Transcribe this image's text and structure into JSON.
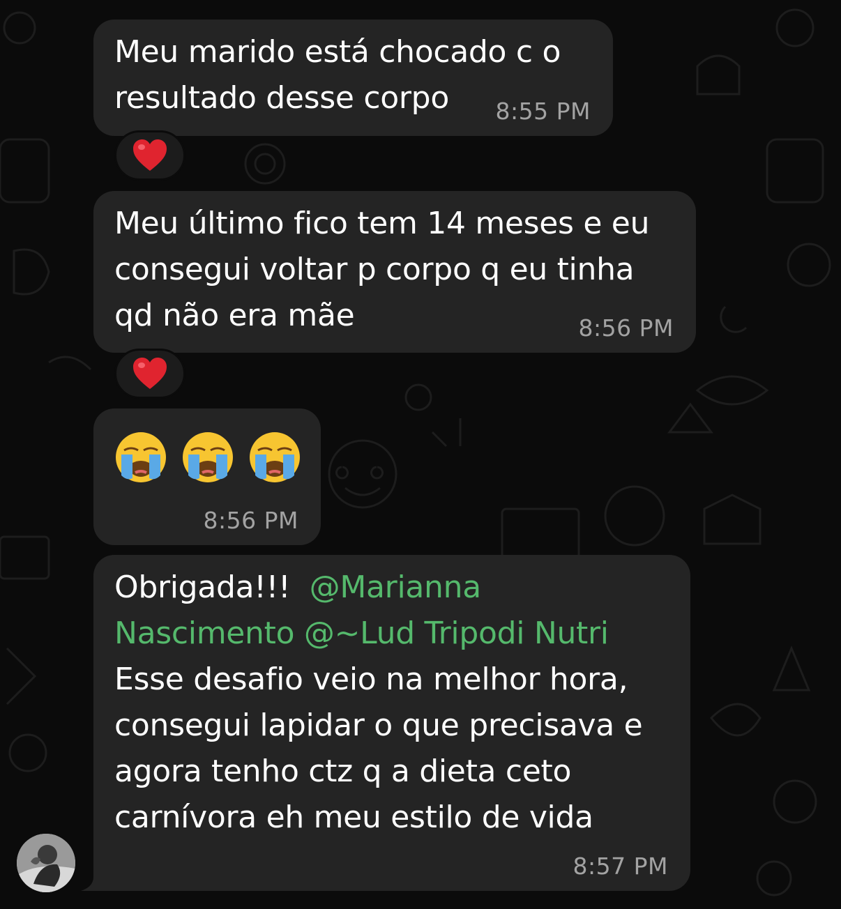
{
  "messages": [
    {
      "lines": [
        "Meu marido está chocado c o",
        "resultado desse corpo"
      ],
      "time": "8:55 PM",
      "reaction": "heart"
    },
    {
      "lines": [
        "Meu último fico tem 14 meses e eu",
        "consegui voltar p corpo q eu tinha",
        "qd não era mãe"
      ],
      "time": "8:56 PM",
      "reaction": "heart"
    },
    {
      "emojis": [
        "loudly-crying-face",
        "loudly-crying-face",
        "loudly-crying-face"
      ],
      "time": "8:56 PM"
    },
    {
      "line1_text": "Obrigada!!!  ",
      "mention1_part1": "@Marianna",
      "mention1_part2": "Nascimento",
      "mention2": "@~Lud Tripodi Nutri",
      "lines": [
        "Esse desafio veio na melhor hora,",
        "consegui lapidar o que precisava e",
        "agora tenho ctz q a dieta ceto",
        "carnívora eh meu estilo de vida"
      ],
      "time": "8:57 PM"
    }
  ],
  "colors": {
    "background": "#0b0b0b",
    "bubble": "#242424",
    "text": "#ffffff",
    "timestamp": "#a3a3a3",
    "mention": "#55b96c",
    "heart": "#e0242f"
  }
}
